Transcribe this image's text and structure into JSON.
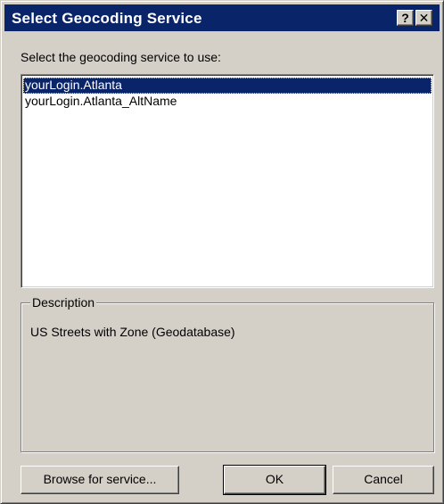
{
  "dialog": {
    "title": "Select Geocoding Service",
    "help_button": "?",
    "close_button": "✕"
  },
  "prompt": "Select the geocoding service to use:",
  "services": [
    {
      "label": "yourLogin.Atlanta",
      "selected": true
    },
    {
      "label": "yourLogin.Atlanta_AltName",
      "selected": false
    }
  ],
  "description": {
    "legend": "Description",
    "text": "US Streets with Zone (Geodatabase)"
  },
  "buttons": {
    "browse": "Browse for service...",
    "ok": "OK",
    "cancel": "Cancel"
  },
  "colors": {
    "titlebar": "#0a246a",
    "dialog_bg": "#d4d0c8",
    "selection": "#0a246a"
  }
}
